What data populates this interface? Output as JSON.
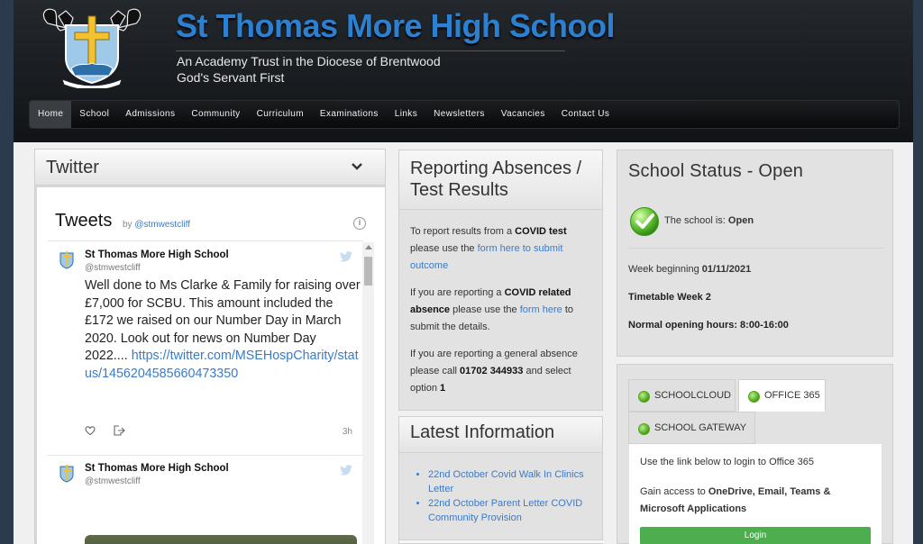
{
  "header": {
    "title": "St Thomas More High School",
    "subtitle_1": "An Academy Trust in the Diocese of Brentwood",
    "subtitle_2": "God's Servant First",
    "crest_motto": "GOD'S SERVANT FIRST"
  },
  "nav": {
    "items": [
      "Home",
      "School",
      "Admissions",
      "Community",
      "Curriculum",
      "Examinations",
      "Links",
      "Newsletters",
      "Vacancies",
      "Contact Us"
    ],
    "active": "Home"
  },
  "twitter": {
    "panel_title": "Twitter",
    "tweets_label": "Tweets",
    "by_label": "by",
    "handle_link": "@stmwestcliff",
    "tweets": [
      {
        "name": "St Thomas More High School",
        "handle": "@stmwestcliff",
        "text": "Well done to Ms Clarke & Family for raising over £7,000 for SCBU. This amount included the £172 we raised on our Number Day in March 2020. Look out for news on Number Day 2022....",
        "link": "https://twitter.com/MSEHospCharity/status/1456204585660473350",
        "time": "3h"
      },
      {
        "name": "St Thomas More High School",
        "handle": "@stmwestcliff"
      }
    ]
  },
  "reporting": {
    "title": "Reporting Absences / Test Results",
    "p1_pre": "To report results from a ",
    "p1_bold": "COVID test",
    "p1_mid": " please use the ",
    "p1_link": "form here to submit outcome",
    "p2_pre": "If you are reporting a ",
    "p2_bold": "COVID related absence",
    "p2_mid": " please use the ",
    "p2_link": "form here",
    "p2_post": " to submit the details.",
    "p3_pre": "If you are reporting a general absence please call ",
    "p3_bold": "01702 344933",
    "p3_mid": " and select option ",
    "p3_bold2": "1"
  },
  "latest": {
    "title": "Latest Information",
    "items": [
      "22nd October Covid Walk In Clinics Letter",
      "22nd October Parent Letter COVID Community Provision"
    ]
  },
  "status": {
    "title": "School Status - Open",
    "line_label": "The school is: ",
    "line_value": "Open",
    "week_label": "Week beginning ",
    "week_value": "01/11/2021",
    "timetable": "Timetable Week 2",
    "hours": "Normal opening hours: 8:00-16:00"
  },
  "login": {
    "tabs": [
      "SCHOOLCLOUD",
      "OFFICE 365",
      "SCHOOL GATEWAY"
    ],
    "active_tab": "OFFICE 365",
    "text1": "Use the link below to login to Office 365",
    "text2_pre": "Gain access to ",
    "text2_bold1": "OneDrive",
    "text2_sep1": ", ",
    "text2_bold2": "Email",
    "text2_sep2": ", ",
    "text2_bold3": "Teams & Microsoft Applications",
    "button": "Login"
  },
  "colors": {
    "title_blue": "#2d7fd0",
    "link_blue": "#3a7bc8",
    "login_green": "#4cae4c"
  }
}
